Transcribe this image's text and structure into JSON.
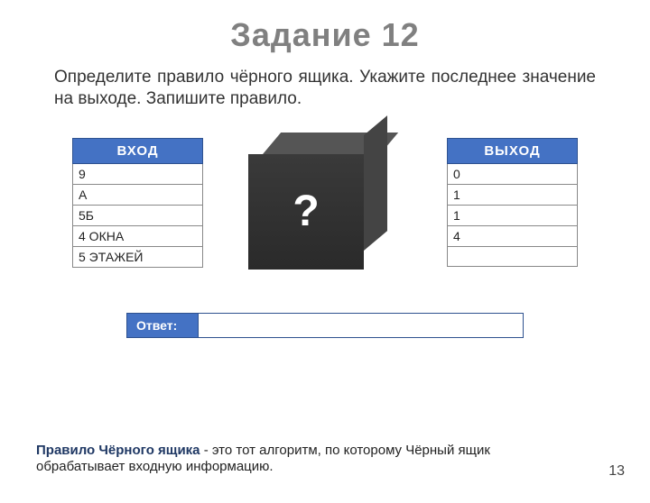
{
  "title": "Задание 12",
  "prompt": "Определите правило чёрного ящика. Укажите последнее значение на выходе. Запишите правило.",
  "input": {
    "header": "ВХОД",
    "rows": [
      "9",
      "А",
      "5Б",
      "4 ОКНА",
      "5 ЭТАЖЕЙ"
    ]
  },
  "output": {
    "header": "ВЫХОД",
    "rows": [
      "0",
      "1",
      "1",
      "4",
      ""
    ]
  },
  "cube_mark": "?",
  "answer": {
    "label": "Ответ:",
    "value": ""
  },
  "footnote": {
    "strong": "Правило Чёрного ящика",
    "rest": " - это тот алгоритм, по которому Чёрный ящик обрабатывает входную информацию."
  },
  "page_number": "13"
}
